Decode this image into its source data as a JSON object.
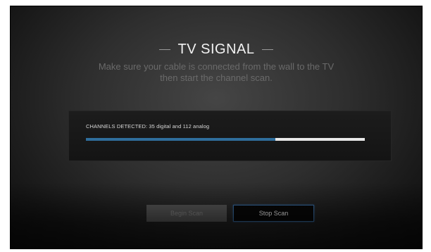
{
  "screen": {
    "title": "TV SIGNAL",
    "subtitle_line1": "Make sure your cable is connected from the wall to the TV",
    "subtitle_line2": "then start the channel scan."
  },
  "scan_panel": {
    "status_label": "CHANNELS DETECTED: 35 digital and 112 analog",
    "progress_fraction": 0.68
  },
  "buttons": {
    "begin_scan": "Begin Scan",
    "stop_scan": "Stop Scan"
  },
  "colors": {
    "accent": "#2f6e9c",
    "focus_border": "#3a6fa6"
  }
}
